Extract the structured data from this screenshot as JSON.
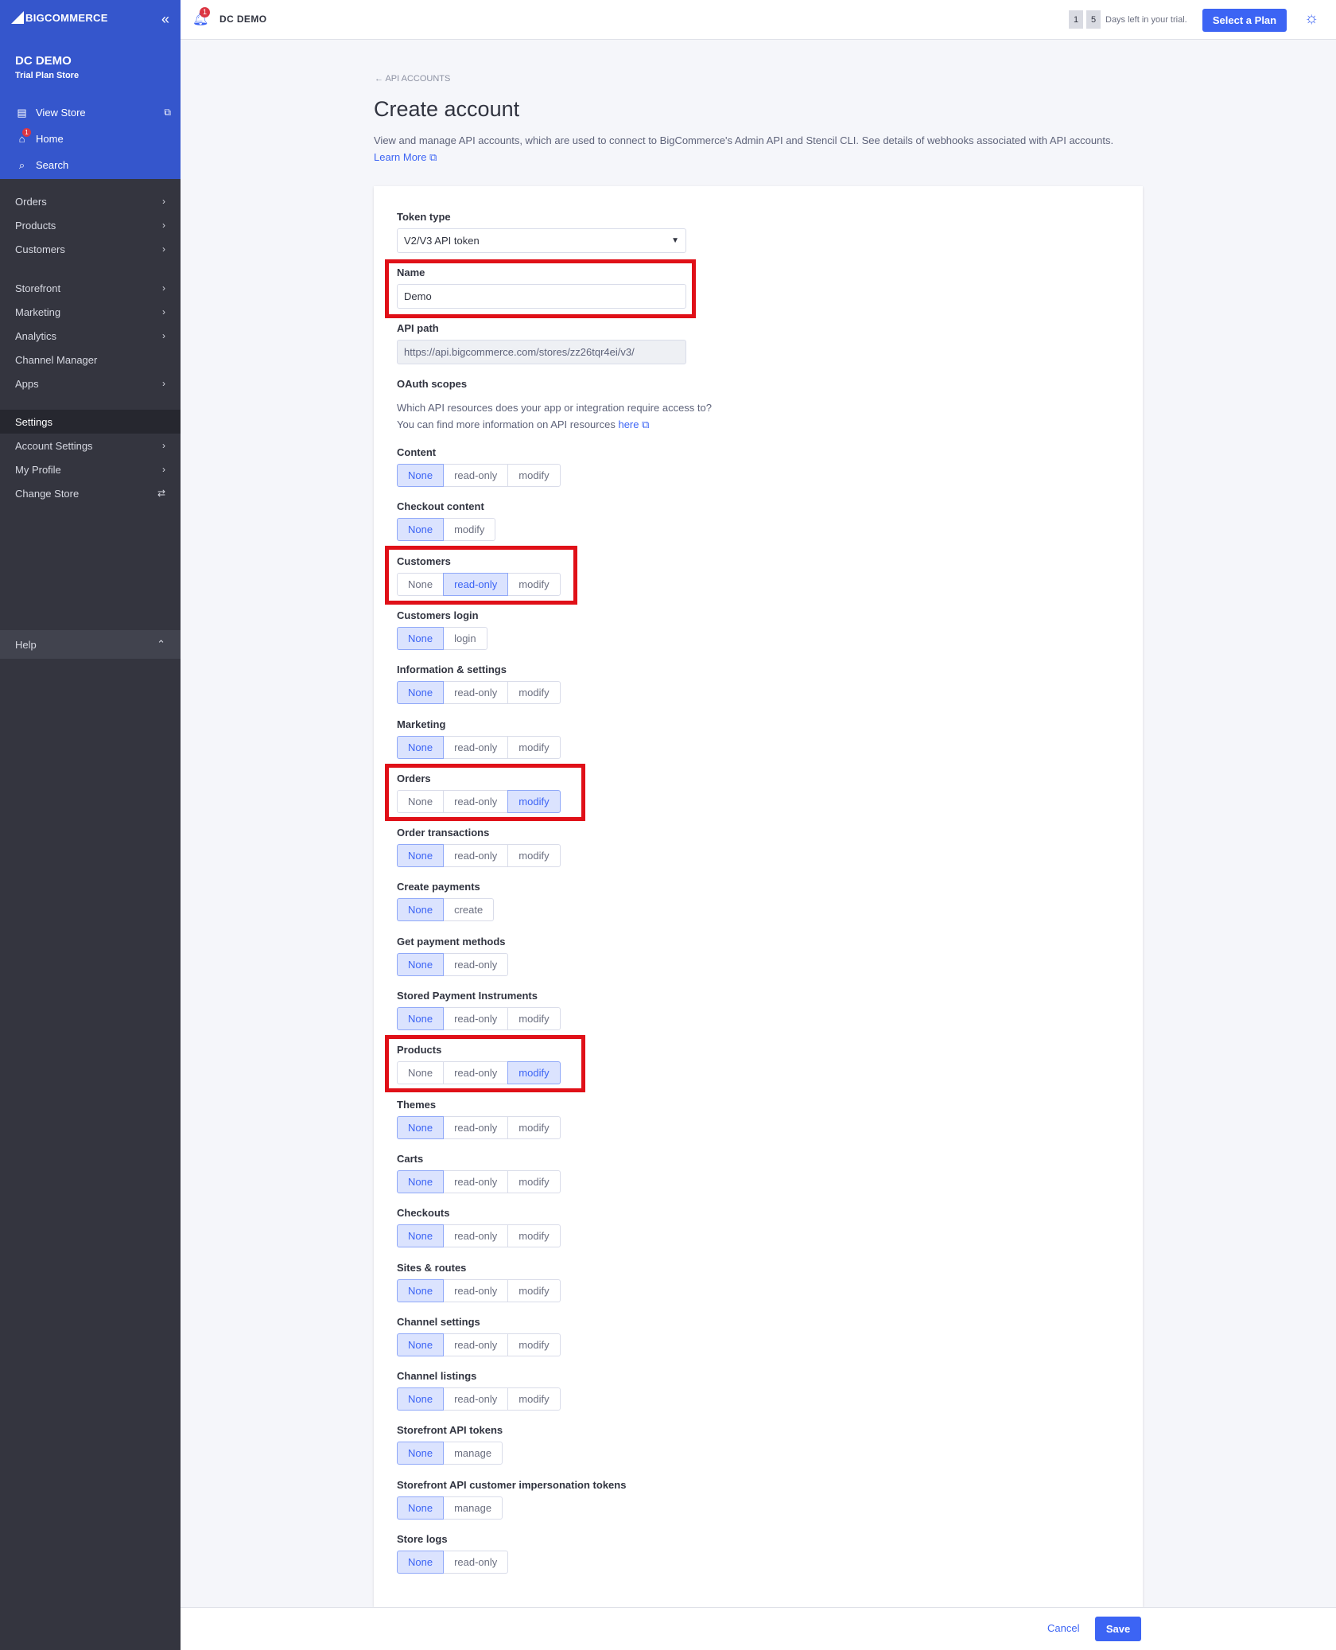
{
  "sidebar": {
    "logo_big": "BIG",
    "logo_commerce": "COMMERCE",
    "collapse_icon": "«",
    "store_name": "DC DEMO",
    "plan": "Trial Plan Store",
    "links": [
      {
        "label": "View Store",
        "icon": "store-icon"
      },
      {
        "label": "Home",
        "icon": "home-icon",
        "badge": "1"
      },
      {
        "label": "Search",
        "icon": "search-icon"
      }
    ],
    "nav": [
      {
        "label": "Orders",
        "chevron": "›"
      },
      {
        "label": "Products",
        "chevron": "›"
      },
      {
        "label": "Customers",
        "chevron": "›"
      },
      {
        "label": "Storefront",
        "chevron": "›"
      },
      {
        "label": "Marketing",
        "chevron": "›"
      },
      {
        "label": "Analytics",
        "chevron": "›"
      },
      {
        "label": "Channel Manager",
        "chevron": ""
      },
      {
        "label": "Apps",
        "chevron": "›"
      },
      {
        "label": "Settings",
        "chevron": ""
      },
      {
        "label": "Account Settings",
        "chevron": "›"
      },
      {
        "label": "My Profile",
        "chevron": "›"
      },
      {
        "label": "Change Store",
        "chevron": "⇄"
      }
    ],
    "help": "Help"
  },
  "topbar": {
    "notif_count": "1",
    "store": "DC DEMO",
    "trial_digit1": "1",
    "trial_digit2": "5",
    "trial_text": "Days left in your trial.",
    "plan_button": "Select a Plan"
  },
  "page": {
    "breadcrumb": "← API ACCOUNTS",
    "title": "Create account",
    "description": "View and manage API accounts, which are used to connect to BigCommerce's Admin API and Stencil CLI. See details of webhooks associated with API accounts.",
    "learn_more": "Learn More"
  },
  "form": {
    "token_type_label": "Token type",
    "token_type_value": "V2/V3 API token",
    "name_label": "Name",
    "name_value": "Demo",
    "api_path_label": "API path",
    "api_path_value": "https://api.bigcommerce.com/stores/zz26tqr4ei/v3/",
    "oauth_label": "OAuth scopes",
    "oauth_line1": "Which API resources does your app or integration require access to?",
    "oauth_line2": "You can find more information on API resources",
    "oauth_link": "here"
  },
  "scopes": [
    {
      "label": "Content",
      "options": [
        "None",
        "read-only",
        "modify"
      ],
      "selected": 0
    },
    {
      "label": "Checkout content",
      "options": [
        "None",
        "modify"
      ],
      "selected": 0
    },
    {
      "label": "Customers",
      "options": [
        "None",
        "read-only",
        "modify"
      ],
      "selected": 1
    },
    {
      "label": "Customers login",
      "options": [
        "None",
        "login"
      ],
      "selected": 0
    },
    {
      "label": "Information & settings",
      "options": [
        "None",
        "read-only",
        "modify"
      ],
      "selected": 0
    },
    {
      "label": "Marketing",
      "options": [
        "None",
        "read-only",
        "modify"
      ],
      "selected": 0
    },
    {
      "label": "Orders",
      "options": [
        "None",
        "read-only",
        "modify"
      ],
      "selected": 2
    },
    {
      "label": "Order transactions",
      "options": [
        "None",
        "read-only",
        "modify"
      ],
      "selected": 0
    },
    {
      "label": "Create payments",
      "options": [
        "None",
        "create"
      ],
      "selected": 0
    },
    {
      "label": "Get payment methods",
      "options": [
        "None",
        "read-only"
      ],
      "selected": 0
    },
    {
      "label": "Stored Payment Instruments",
      "options": [
        "None",
        "read-only",
        "modify"
      ],
      "selected": 0
    },
    {
      "label": "Products",
      "options": [
        "None",
        "read-only",
        "modify"
      ],
      "selected": 2
    },
    {
      "label": "Themes",
      "options": [
        "None",
        "read-only",
        "modify"
      ],
      "selected": 0
    },
    {
      "label": "Carts",
      "options": [
        "None",
        "read-only",
        "modify"
      ],
      "selected": 0
    },
    {
      "label": "Checkouts",
      "options": [
        "None",
        "read-only",
        "modify"
      ],
      "selected": 0
    },
    {
      "label": "Sites & routes",
      "options": [
        "None",
        "read-only",
        "modify"
      ],
      "selected": 0
    },
    {
      "label": "Channel settings",
      "options": [
        "None",
        "read-only",
        "modify"
      ],
      "selected": 0
    },
    {
      "label": "Channel listings",
      "options": [
        "None",
        "read-only",
        "modify"
      ],
      "selected": 0
    },
    {
      "label": "Storefront API tokens",
      "options": [
        "None",
        "manage"
      ],
      "selected": 0
    },
    {
      "label": "Storefront API customer impersonation tokens",
      "options": [
        "None",
        "manage"
      ],
      "selected": 0
    },
    {
      "label": "Store logs",
      "options": [
        "None",
        "read-only"
      ],
      "selected": 0
    }
  ],
  "footer": {
    "cancel": "Cancel",
    "save": "Save"
  },
  "colors": {
    "primary": "#3c64f4",
    "sidebar": "#34353f",
    "highlight": "#e01018"
  }
}
